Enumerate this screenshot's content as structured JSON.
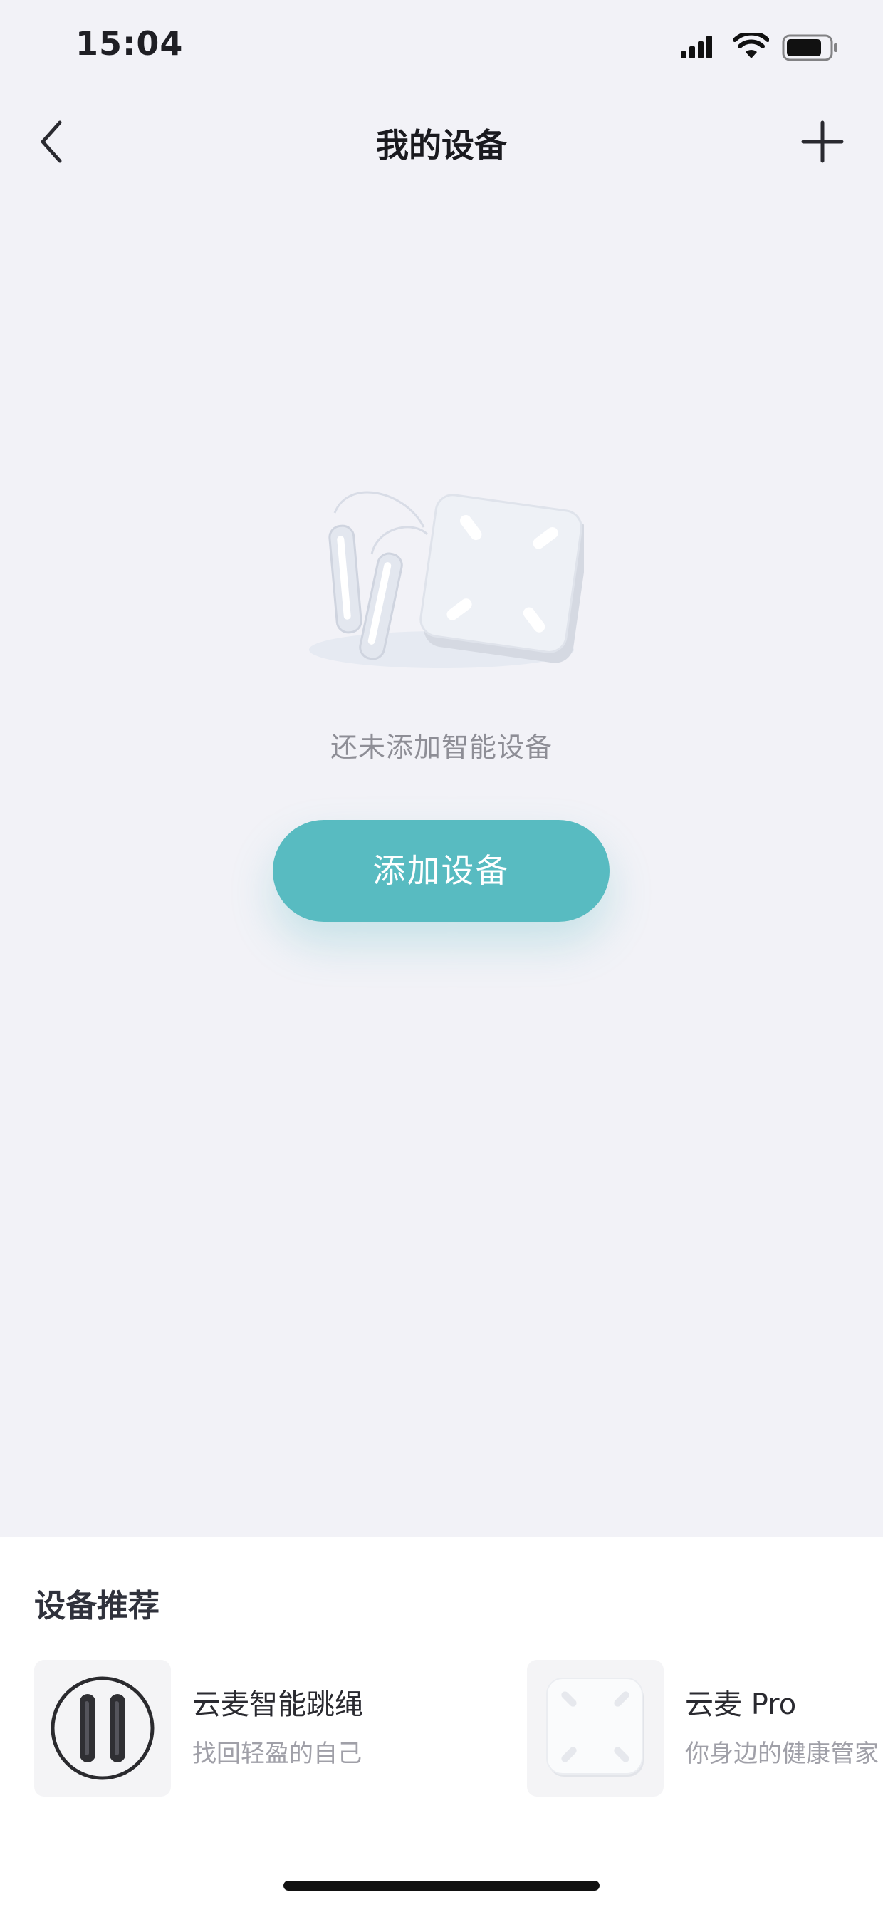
{
  "status_bar": {
    "time": "15:04"
  },
  "nav": {
    "title": "我的设备",
    "back_icon": "chevron-left-icon",
    "add_icon": "plus-icon"
  },
  "empty_state": {
    "message": "还未添加智能设备",
    "button_label": "添加设备",
    "illustration": "jump-rope-and-scale-illustration"
  },
  "recommend": {
    "title": "设备推荐",
    "items": [
      {
        "name": "云麦智能跳绳",
        "desc": "找回轻盈的自己",
        "icon": "jump-rope-icon"
      },
      {
        "name": "云麦 Pro",
        "desc": "你身边的健康管家",
        "icon": "smart-scale-icon"
      }
    ]
  },
  "colors": {
    "accent": "#58bbc1",
    "background": "#f2f2f7",
    "panel": "#ffffff"
  }
}
